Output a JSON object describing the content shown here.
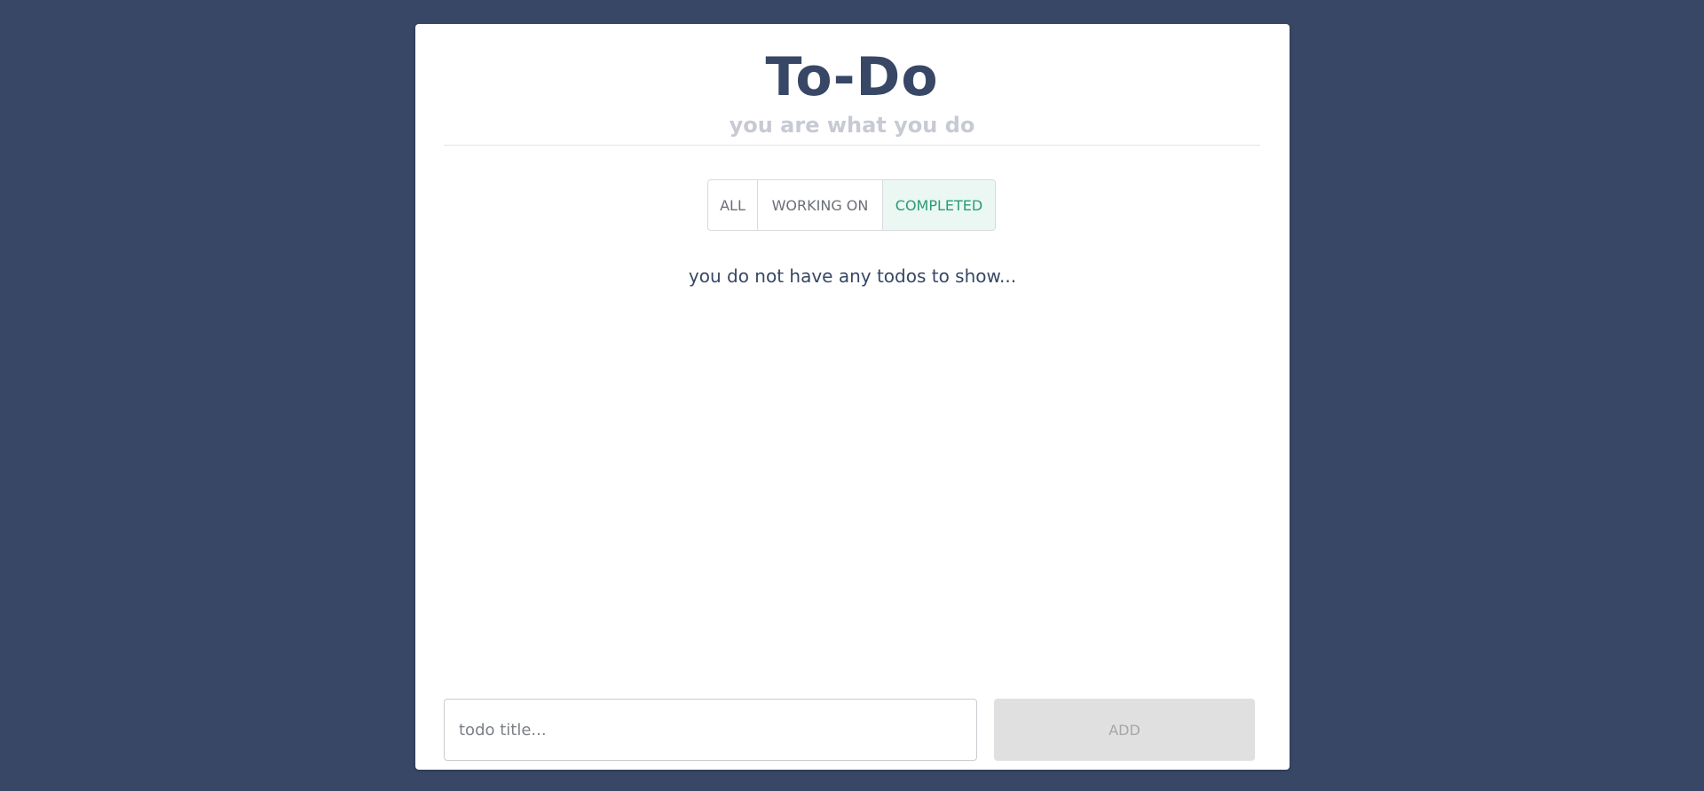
{
  "header": {
    "title": "To-Do",
    "subtitle": "you are what you do"
  },
  "filters": {
    "items": [
      {
        "label": "ALL",
        "active": false
      },
      {
        "label": "WORKING ON",
        "active": false
      },
      {
        "label": "COMPLETED",
        "active": true
      }
    ]
  },
  "list": {
    "empty_message": "you do not have any todos to show..."
  },
  "form": {
    "input_placeholder": "todo title...",
    "input_value": "",
    "add_label": "ADD",
    "add_disabled": true
  },
  "colors": {
    "background": "#374765",
    "card": "#ffffff",
    "title": "#374765",
    "subtitle": "#c7cad3",
    "active_filter_bg": "#eaf7f2",
    "active_filter_text": "#2b9b72",
    "button_disabled_bg": "#e0e0e0"
  }
}
